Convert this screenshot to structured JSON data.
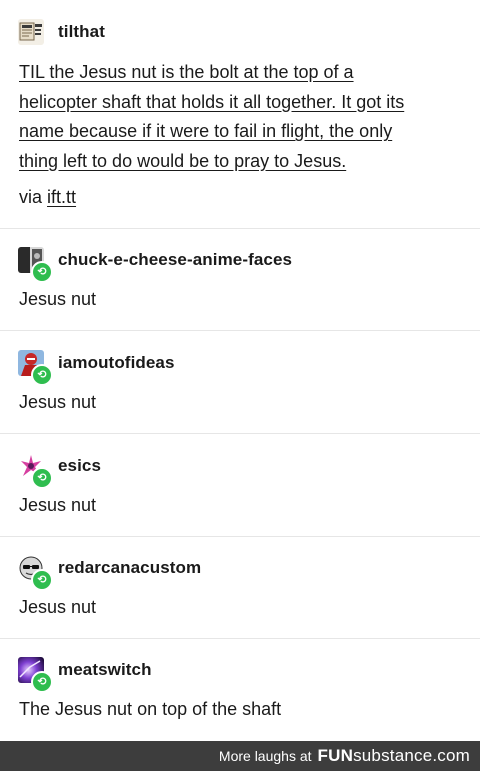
{
  "op": {
    "username": "tilthat",
    "avatar_icon": "newspaper-avatar-icon",
    "text_lines": [
      "TIL the Jesus nut is the bolt at the top of a",
      "helicopter shaft that holds it all together. It got its",
      "name because if it were to fail in flight, the only",
      "thing left to do would be to pray to Jesus."
    ],
    "via_prefix": "via",
    "via_link": "ift.tt"
  },
  "reblogs": [
    {
      "username": "chuck-e-cheese-anime-faces",
      "text": "Jesus nut",
      "avatar_icon": "dark-avatar-icon"
    },
    {
      "username": "iamoutofideas",
      "text": "Jesus nut",
      "avatar_icon": "red-figure-avatar-icon"
    },
    {
      "username": "esics",
      "text": "Jesus nut",
      "avatar_icon": "pink-sparkle-avatar-icon"
    },
    {
      "username": "redarcanacustom",
      "text": "Jesus nut",
      "avatar_icon": "skull-sunglasses-avatar-icon"
    },
    {
      "username": "meatswitch",
      "text": "The Jesus nut on top of the shaft",
      "avatar_icon": "purple-glow-avatar-icon"
    }
  ],
  "reblog_badge_icon": "reblog-icon",
  "footer": {
    "prefix": "More laughs at",
    "brand_bold": "FUN",
    "brand_rest": "substance.com"
  },
  "colors": {
    "reblog_green": "#2fbd4f",
    "footer_bg": "#3d3d3d",
    "divider": "#e6e6e6"
  }
}
